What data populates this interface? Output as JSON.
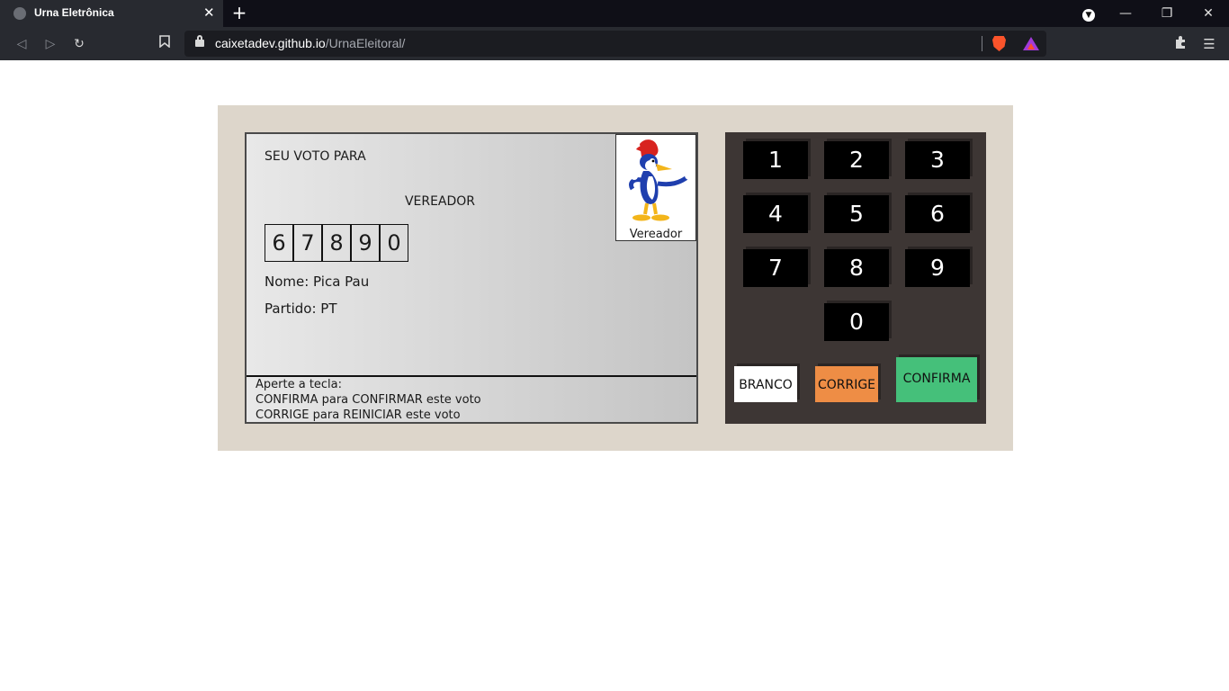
{
  "browser": {
    "tab_title": "Urna Eletrônica",
    "tab_close": "✕",
    "new_tab": "+",
    "url_host": "caixetadev.github.io",
    "url_path": "/UrnaEleitoral/"
  },
  "window_controls": {
    "minimize": "—",
    "restore": "❐",
    "close": "✕"
  },
  "screen": {
    "header": "SEU VOTO PARA",
    "cargo": "VEREADOR",
    "digits": [
      "6",
      "7",
      "8",
      "9",
      "0"
    ],
    "nome": "Nome: Pica Pau",
    "partido": "Partido: PT",
    "photo_caption": "Vereador",
    "instructions": [
      "Aperte a tecla:",
      "CONFIRMA para CONFIRMAR este voto",
      "CORRIGE para REINICIAR este voto"
    ]
  },
  "keypad": {
    "keys": [
      "1",
      "2",
      "3",
      "4",
      "5",
      "6",
      "7",
      "8",
      "9",
      "0"
    ],
    "branco": "BRANCO",
    "corrige": "CORRIGE",
    "confirma": "CONFIRMA"
  },
  "colors": {
    "urna_body": "#ddd6cb",
    "keypad_bg": "#3d3634",
    "branco": "#ffffff",
    "corrige": "#ee8d45",
    "confirma": "#45c07a"
  }
}
